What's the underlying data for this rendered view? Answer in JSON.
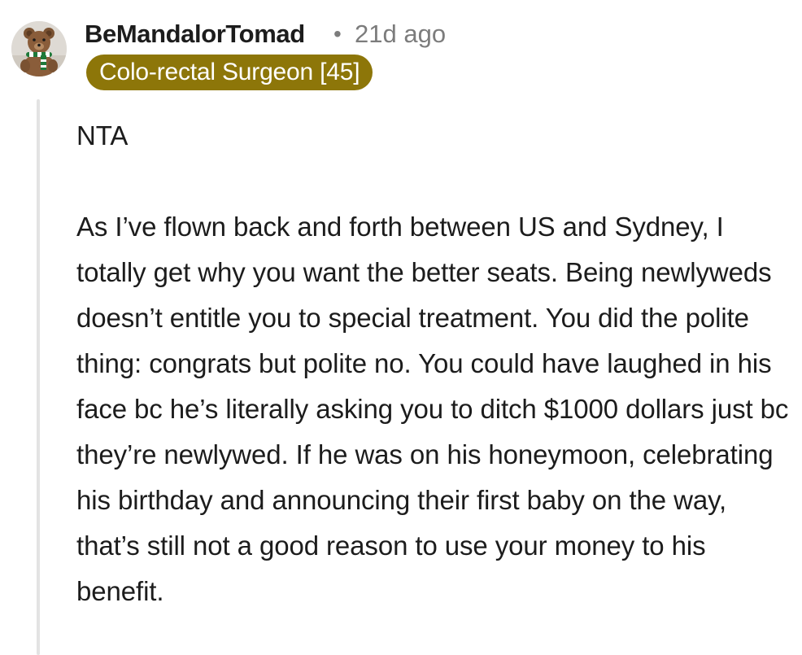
{
  "comment": {
    "username": "BeMandalorTomad",
    "separator": "•",
    "time": "21d ago",
    "flair": "Colo-rectal Surgeon [45]",
    "avatar_icon": "teddy-bear-avatar-icon",
    "flair_color": "#8d7609",
    "body": {
      "para_1": "NTA",
      "para_2": "As I’ve flown back and forth between US and Sydney, I totally get why you want the better seats. Being newlyweds doesn’t entitle you to special treatment. You did the polite thing: congrats but polite no. You could have laughed in his face bc he’s literally asking you to ditch $1000 dollars just bc they’re newlywed. If he was on his honeymoon, celebrating his birthday and announcing their first baby on the way, that’s still not a good reason to use your money to his benefit."
    }
  }
}
